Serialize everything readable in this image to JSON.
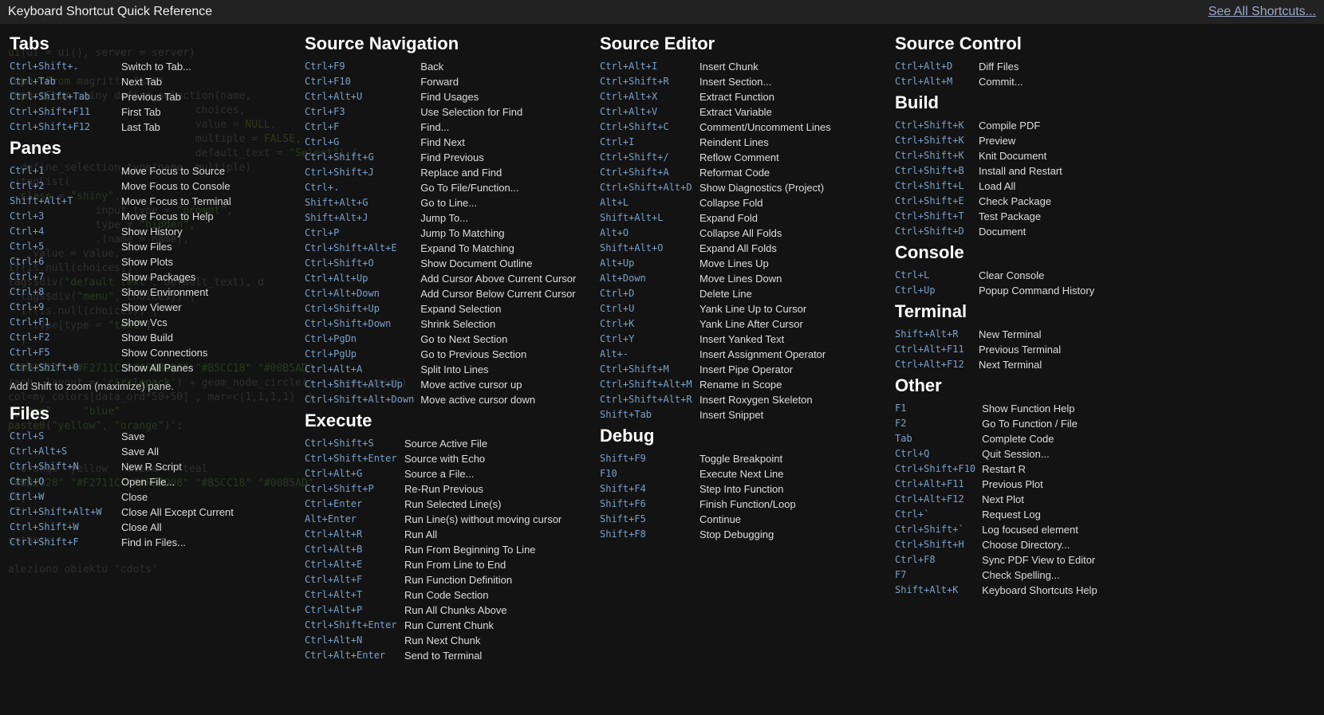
{
  "header": {
    "title": "Keyboard Shortcut Quick Reference",
    "see_all": "See All Shortcuts..."
  },
  "sections": {
    "tabs": {
      "title": "Tabs",
      "items": [
        {
          "k": "Ctrl+Shift+.",
          "d": "Switch to Tab..."
        },
        {
          "k": "Ctrl+Tab",
          "d": "Next Tab"
        },
        {
          "k": "Ctrl+Shift+Tab",
          "d": "Previous Tab"
        },
        {
          "k": "Ctrl+Shift+F11",
          "d": "First Tab"
        },
        {
          "k": "Ctrl+Shift+F12",
          "d": "Last Tab"
        }
      ]
    },
    "panes": {
      "title": "Panes",
      "note": "Add Shift to zoom (maximize) pane.",
      "items": [
        {
          "k": "Ctrl+1",
          "d": "Move Focus to Source"
        },
        {
          "k": "Ctrl+2",
          "d": "Move Focus to Console"
        },
        {
          "k": "Shift+Alt+T",
          "d": "Move Focus to Terminal"
        },
        {
          "k": "Ctrl+3",
          "d": "Move Focus to Help"
        },
        {
          "k": "Ctrl+4",
          "d": "Show History"
        },
        {
          "k": "Ctrl+5",
          "d": "Show Files"
        },
        {
          "k": "Ctrl+6",
          "d": "Show Plots"
        },
        {
          "k": "Ctrl+7",
          "d": "Show Packages"
        },
        {
          "k": "Ctrl+8",
          "d": "Show Environment"
        },
        {
          "k": "Ctrl+9",
          "d": "Show Viewer"
        },
        {
          "k": "Ctrl+F1",
          "d": "Show Vcs"
        },
        {
          "k": "Ctrl+F2",
          "d": "Show Build"
        },
        {
          "k": "Ctrl+F5",
          "d": "Show Connections"
        },
        {
          "k": "Ctrl+Shift+0",
          "d": "Show All Panes"
        }
      ]
    },
    "files": {
      "title": "Files",
      "items": [
        {
          "k": "Ctrl+S",
          "d": "Save"
        },
        {
          "k": "Ctrl+Alt+S",
          "d": "Save All"
        },
        {
          "k": "Ctrl+Shift+N",
          "d": "New R Script"
        },
        {
          "k": "Ctrl+O",
          "d": "Open File..."
        },
        {
          "k": "Ctrl+W",
          "d": "Close"
        },
        {
          "k": "Ctrl+Shift+Alt+W",
          "d": "Close All Except Current"
        },
        {
          "k": "Ctrl+Shift+W",
          "d": "Close All"
        },
        {
          "k": "Ctrl+Shift+F",
          "d": "Find in Files..."
        }
      ]
    },
    "source_nav": {
      "title": "Source Navigation",
      "items": [
        {
          "k": "Ctrl+F9",
          "d": "Back"
        },
        {
          "k": "Ctrl+F10",
          "d": "Forward"
        },
        {
          "k": "Ctrl+Alt+U",
          "d": "Find Usages"
        },
        {
          "k": "Ctrl+F3",
          "d": "Use Selection for Find"
        },
        {
          "k": "Ctrl+F",
          "d": "Find..."
        },
        {
          "k": "Ctrl+G",
          "d": "Find Next"
        },
        {
          "k": "Ctrl+Shift+G",
          "d": "Find Previous"
        },
        {
          "k": "Ctrl+Shift+J",
          "d": "Replace and Find"
        },
        {
          "k": "Ctrl+.",
          "d": "Go To File/Function..."
        },
        {
          "k": "Shift+Alt+G",
          "d": "Go to Line..."
        },
        {
          "k": "Shift+Alt+J",
          "d": "Jump To..."
        },
        {
          "k": "Ctrl+P",
          "d": "Jump To Matching"
        },
        {
          "k": "Ctrl+Shift+Alt+E",
          "d": "Expand To Matching"
        },
        {
          "k": "Ctrl+Shift+O",
          "d": "Show Document Outline"
        },
        {
          "k": "Ctrl+Alt+Up",
          "d": "Add Cursor Above Current Cursor"
        },
        {
          "k": "Ctrl+Alt+Down",
          "d": "Add Cursor Below Current Cursor"
        },
        {
          "k": "Ctrl+Shift+Up",
          "d": "Expand Selection"
        },
        {
          "k": "Ctrl+Shift+Down",
          "d": "Shrink Selection"
        },
        {
          "k": "Ctrl+PgDn",
          "d": "Go to Next Section"
        },
        {
          "k": "Ctrl+PgUp",
          "d": "Go to Previous Section"
        },
        {
          "k": "Ctrl+Alt+A",
          "d": "Split Into Lines"
        },
        {
          "k": "Ctrl+Shift+Alt+Up",
          "d": "Move active cursor up"
        },
        {
          "k": "Ctrl+Shift+Alt+Down",
          "d": "Move active cursor down"
        }
      ]
    },
    "execute": {
      "title": "Execute",
      "items": [
        {
          "k": "Ctrl+Shift+S",
          "d": "Source Active File"
        },
        {
          "k": "Ctrl+Shift+Enter",
          "d": "Source with Echo"
        },
        {
          "k": "Ctrl+Alt+G",
          "d": "Source a File..."
        },
        {
          "k": "Ctrl+Shift+P",
          "d": "Re-Run Previous"
        },
        {
          "k": "Ctrl+Enter",
          "d": "Run Selected Line(s)"
        },
        {
          "k": "Alt+Enter",
          "d": "Run Line(s) without moving cursor"
        },
        {
          "k": "Ctrl+Alt+R",
          "d": "Run All"
        },
        {
          "k": "Ctrl+Alt+B",
          "d": "Run From Beginning To Line"
        },
        {
          "k": "Ctrl+Alt+E",
          "d": "Run From Line to End"
        },
        {
          "k": "Ctrl+Alt+F",
          "d": "Run Function Definition"
        },
        {
          "k": "Ctrl+Alt+T",
          "d": "Run Code Section"
        },
        {
          "k": "Ctrl+Alt+P",
          "d": "Run All Chunks Above"
        },
        {
          "k": "Ctrl+Shift+Enter",
          "d": "Run Current Chunk"
        },
        {
          "k": "Ctrl+Alt+N",
          "d": "Run Next Chunk"
        },
        {
          "k": "Ctrl+Alt+Enter",
          "d": "Send to Terminal"
        }
      ]
    },
    "source_editor": {
      "title": "Source Editor",
      "items": [
        {
          "k": "Ctrl+Alt+I",
          "d": "Insert Chunk"
        },
        {
          "k": "Ctrl+Shift+R",
          "d": "Insert Section..."
        },
        {
          "k": "Ctrl+Alt+X",
          "d": "Extract Function"
        },
        {
          "k": "Ctrl+Alt+V",
          "d": "Extract Variable"
        },
        {
          "k": "Ctrl+Shift+C",
          "d": "Comment/Uncomment Lines"
        },
        {
          "k": "Ctrl+I",
          "d": "Reindent Lines"
        },
        {
          "k": "Ctrl+Shift+/",
          "d": "Reflow Comment"
        },
        {
          "k": "Ctrl+Shift+A",
          "d": "Reformat Code"
        },
        {
          "k": "Ctrl+Shift+Alt+D",
          "d": "Show Diagnostics (Project)"
        },
        {
          "k": "Alt+L",
          "d": "Collapse Fold"
        },
        {
          "k": "Shift+Alt+L",
          "d": "Expand Fold"
        },
        {
          "k": "Alt+O",
          "d": "Collapse All Folds"
        },
        {
          "k": "Shift+Alt+O",
          "d": "Expand All Folds"
        },
        {
          "k": "Alt+Up",
          "d": "Move Lines Up"
        },
        {
          "k": "Alt+Down",
          "d": "Move Lines Down"
        },
        {
          "k": "Ctrl+D",
          "d": "Delete Line"
        },
        {
          "k": "Ctrl+U",
          "d": "Yank Line Up to Cursor"
        },
        {
          "k": "Ctrl+K",
          "d": "Yank Line After Cursor"
        },
        {
          "k": "Ctrl+Y",
          "d": "Insert Yanked Text"
        },
        {
          "k": "Alt+-",
          "d": "Insert Assignment Operator"
        },
        {
          "k": "Ctrl+Shift+M",
          "d": "Insert Pipe Operator"
        },
        {
          "k": "Ctrl+Shift+Alt+M",
          "d": "Rename in Scope"
        },
        {
          "k": "Ctrl+Shift+Alt+R",
          "d": "Insert Roxygen Skeleton"
        },
        {
          "k": "Shift+Tab",
          "d": "Insert Snippet"
        }
      ]
    },
    "debug": {
      "title": "Debug",
      "items": [
        {
          "k": "Shift+F9",
          "d": "Toggle Breakpoint"
        },
        {
          "k": "F10",
          "d": "Execute Next Line"
        },
        {
          "k": "Shift+F4",
          "d": "Step Into Function"
        },
        {
          "k": "Shift+F6",
          "d": "Finish Function/Loop"
        },
        {
          "k": "Shift+F5",
          "d": "Continue"
        },
        {
          "k": "Shift+F8",
          "d": "Stop Debugging"
        }
      ]
    },
    "source_control": {
      "title": "Source Control",
      "items": [
        {
          "k": "Ctrl+Alt+D",
          "d": "Diff Files"
        },
        {
          "k": "Ctrl+Alt+M",
          "d": "Commit..."
        }
      ]
    },
    "build": {
      "title": "Build",
      "items": [
        {
          "k": "Ctrl+Shift+K",
          "d": "Compile PDF"
        },
        {
          "k": "Ctrl+Shift+K",
          "d": "Preview"
        },
        {
          "k": "Ctrl+Shift+K",
          "d": "Knit Document"
        },
        {
          "k": "Ctrl+Shift+B",
          "d": "Install and Restart"
        },
        {
          "k": "Ctrl+Shift+L",
          "d": "Load All"
        },
        {
          "k": "Ctrl+Shift+E",
          "d": "Check Package"
        },
        {
          "k": "Ctrl+Shift+T",
          "d": "Test Package"
        },
        {
          "k": "Ctrl+Shift+D",
          "d": "Document"
        }
      ]
    },
    "console": {
      "title": "Console",
      "items": [
        {
          "k": "Ctrl+L",
          "d": "Clear Console"
        },
        {
          "k": "Ctrl+Up",
          "d": "Popup Command History"
        }
      ]
    },
    "terminal": {
      "title": "Terminal",
      "items": [
        {
          "k": "Shift+Alt+R",
          "d": "New Terminal"
        },
        {
          "k": "Ctrl+Alt+F11",
          "d": "Previous Terminal"
        },
        {
          "k": "Ctrl+Alt+F12",
          "d": "Next Terminal"
        }
      ]
    },
    "other": {
      "title": "Other",
      "items": [
        {
          "k": "F1",
          "d": "Show Function Help"
        },
        {
          "k": "F2",
          "d": "Go To Function / File"
        },
        {
          "k": "Tab",
          "d": "Complete Code"
        },
        {
          "k": "Ctrl+Q",
          "d": "Quit Session..."
        },
        {
          "k": "Ctrl+Shift+F10",
          "d": "Restart R"
        },
        {
          "k": "Ctrl+Alt+F11",
          "d": "Previous Plot"
        },
        {
          "k": "Ctrl+Alt+F12",
          "d": "Next Plot"
        },
        {
          "k": "Ctrl+`",
          "d": "Request Log"
        },
        {
          "k": "Ctrl+Shift+`",
          "d": "Log focused element"
        },
        {
          "k": "Ctrl+Shift+H",
          "d": "Choose Directory..."
        },
        {
          "k": "Ctrl+F8",
          "d": "Sync PDF View to Editor"
        },
        {
          "k": "F7",
          "d": "Check Spelling..."
        },
        {
          "k": "Shift+Alt+K",
          "d": "Keyboard Shortcuts Help"
        }
      ]
    }
  }
}
